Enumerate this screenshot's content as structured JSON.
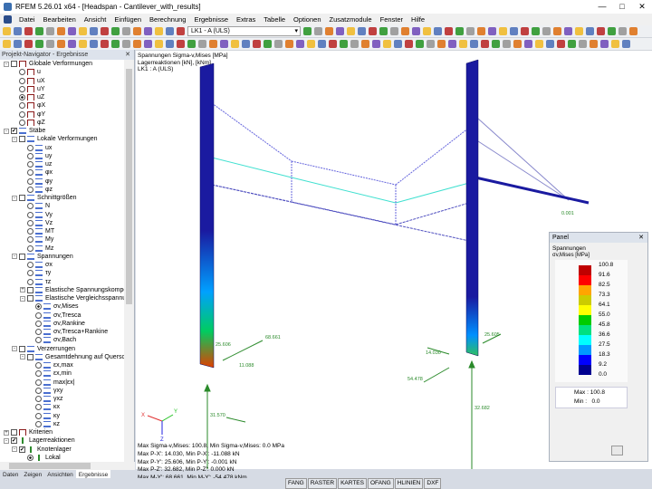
{
  "window": {
    "title": "RFEM 5.26.01 x64 - [Headspan - Cantilever_with_results]",
    "minimize": "—",
    "maximize": "□",
    "close": "✕"
  },
  "menu": [
    "Datei",
    "Bearbeiten",
    "Ansicht",
    "Einfügen",
    "Berechnung",
    "Ergebnisse",
    "Extras",
    "Tabelle",
    "Optionen",
    "Zusatzmodule",
    "Fenster",
    "Hilfe"
  ],
  "toolbar": {
    "loadcase": "LK1 - A (ULS)"
  },
  "navigator": {
    "title": "Projekt-Navigator - Ergebnisse",
    "pin": "ᵖ",
    "close": "✕",
    "items": [
      {
        "label": "Globale Verformungen",
        "level": 0,
        "kind": "chk",
        "icon": "def",
        "pm": "-"
      },
      {
        "label": "u",
        "level": 1,
        "kind": "rad",
        "icon": "def"
      },
      {
        "label": "uX",
        "level": 1,
        "kind": "rad",
        "icon": "def"
      },
      {
        "label": "uY",
        "level": 1,
        "kind": "rad",
        "icon": "def"
      },
      {
        "label": "uZ",
        "level": 1,
        "kind": "rad",
        "icon": "def",
        "on": true
      },
      {
        "label": "φX",
        "level": 1,
        "kind": "rad",
        "icon": "def"
      },
      {
        "label": "φY",
        "level": 1,
        "kind": "rad",
        "icon": "def"
      },
      {
        "label": "φZ",
        "level": 1,
        "kind": "rad",
        "icon": "def"
      },
      {
        "label": "Stäbe",
        "level": 0,
        "kind": "chk",
        "checked": true,
        "icon": "mem",
        "pm": "-"
      },
      {
        "label": "Lokale Verformungen",
        "level": 1,
        "kind": "chk",
        "icon": "mem",
        "pm": "-"
      },
      {
        "label": "ux",
        "level": 2,
        "kind": "rad",
        "icon": "mem"
      },
      {
        "label": "uy",
        "level": 2,
        "kind": "rad",
        "icon": "mem"
      },
      {
        "label": "uz",
        "level": 2,
        "kind": "rad",
        "icon": "mem"
      },
      {
        "label": "φx",
        "level": 2,
        "kind": "rad",
        "icon": "mem"
      },
      {
        "label": "φy",
        "level": 2,
        "kind": "rad",
        "icon": "mem"
      },
      {
        "label": "φz",
        "level": 2,
        "kind": "rad",
        "icon": "mem"
      },
      {
        "label": "Schnittgrößen",
        "level": 1,
        "kind": "chk",
        "icon": "mem",
        "pm": "-"
      },
      {
        "label": "N",
        "level": 2,
        "kind": "rad",
        "icon": "mem"
      },
      {
        "label": "Vy",
        "level": 2,
        "kind": "rad",
        "icon": "mem"
      },
      {
        "label": "Vz",
        "level": 2,
        "kind": "rad",
        "icon": "mem"
      },
      {
        "label": "MT",
        "level": 2,
        "kind": "rad",
        "icon": "mem"
      },
      {
        "label": "My",
        "level": 2,
        "kind": "rad",
        "icon": "mem"
      },
      {
        "label": "Mz",
        "level": 2,
        "kind": "rad",
        "icon": "mem"
      },
      {
        "label": "Spannungen",
        "level": 1,
        "kind": "chk",
        "icon": "mem",
        "pm": "-"
      },
      {
        "label": "σx",
        "level": 2,
        "kind": "rad",
        "icon": "mem"
      },
      {
        "label": "τy",
        "level": 2,
        "kind": "rad",
        "icon": "mem"
      },
      {
        "label": "τz",
        "level": 2,
        "kind": "rad",
        "icon": "mem"
      },
      {
        "label": "Elastische Spannungskomponenten",
        "level": 2,
        "kind": "chk",
        "icon": "mem",
        "pm": "+"
      },
      {
        "label": "Elastische Vergleichsspannungen",
        "level": 2,
        "kind": "chk",
        "icon": "mem",
        "pm": "-"
      },
      {
        "label": "σv,Mises",
        "level": 3,
        "kind": "rad",
        "icon": "mem",
        "on": true
      },
      {
        "label": "σv,Tresca",
        "level": 3,
        "kind": "rad",
        "icon": "mem"
      },
      {
        "label": "σv,Rankine",
        "level": 3,
        "kind": "rad",
        "icon": "mem"
      },
      {
        "label": "σv,Tresca+Rankine",
        "level": 3,
        "kind": "rad",
        "icon": "mem"
      },
      {
        "label": "σv,Bach",
        "level": 3,
        "kind": "rad",
        "icon": "mem"
      },
      {
        "label": "Verzerrungen",
        "level": 1,
        "kind": "chk",
        "icon": "mem",
        "pm": "-"
      },
      {
        "label": "Gesamtdehnung auf Querschnitt",
        "level": 2,
        "kind": "chk",
        "icon": "mem",
        "pm": "-"
      },
      {
        "label": "εx,max",
        "level": 3,
        "kind": "rad",
        "icon": "mem"
      },
      {
        "label": "εx,min",
        "level": 3,
        "kind": "rad",
        "icon": "mem"
      },
      {
        "label": "max|εx|",
        "level": 3,
        "kind": "rad",
        "icon": "mem"
      },
      {
        "label": "γxy",
        "level": 3,
        "kind": "rad",
        "icon": "mem"
      },
      {
        "label": "γxz",
        "level": 3,
        "kind": "rad",
        "icon": "mem"
      },
      {
        "label": "κx",
        "level": 3,
        "kind": "rad",
        "icon": "mem"
      },
      {
        "label": "κy",
        "level": 3,
        "kind": "rad",
        "icon": "mem"
      },
      {
        "label": "κz",
        "level": 3,
        "kind": "rad",
        "icon": "mem"
      },
      {
        "label": "Kriterien",
        "level": 0,
        "kind": "chk",
        "icon": "def",
        "pm": "+"
      },
      {
        "label": "Lagerreaktionen",
        "level": 0,
        "kind": "chk",
        "checked": true,
        "icon": "sup",
        "pm": "-"
      },
      {
        "label": "Knotenlager",
        "level": 1,
        "kind": "chk",
        "checked": true,
        "icon": "sup",
        "pm": "-"
      },
      {
        "label": "Lokal",
        "level": 2,
        "kind": "rad",
        "icon": "sup",
        "on": true
      }
    ],
    "tabs": [
      "Daten",
      "Zeigen",
      "Ansichten",
      "Ergebnisse"
    ]
  },
  "view": {
    "info": [
      "Spannungen Sigma-v,Mises [MPa]",
      "Lagerreaktionen [kN], [kNm]",
      "LK1 : A (ULS)"
    ],
    "minmax": [
      "Max Sigma-v,Mises: 100.8, Min Sigma-v,Mises: 0.0 MPa",
      "Max P-X': 14.030, Min P-X': -11.088 kN",
      "Max P-Y': 25.606, Min P-Y': -0.001 kN",
      "Max P-Z': 32.682, Min P-Z': 0.000 kN",
      "Max M-Y': 68.661, Min M-Y': -54.478 kNm"
    ],
    "labels": {
      "l1": "25.606",
      "l2": "68.661",
      "l3": "11.088",
      "l4": "31.570",
      "r1": "25.605",
      "r2": "14.030",
      "r3": "54.478",
      "r4": "32.682",
      "cant": "0.001"
    },
    "axes": {
      "x": "X",
      "y": "Y",
      "z": "Z"
    }
  },
  "panel": {
    "title": "Panel",
    "close": "✕",
    "heading": "Spannungen",
    "quantity": "σv,Mises [MPa]",
    "scale": [
      "100.8",
      "91.6",
      "82.5",
      "73.3",
      "64.1",
      "55.0",
      "45.8",
      "36.6",
      "27.5",
      "18.3",
      "9.2",
      "0.0"
    ],
    "colors": [
      "#c00000",
      "#ff0000",
      "#ffa500",
      "#cccc00",
      "#ffff00",
      "#00cc00",
      "#00e080",
      "#00ffff",
      "#0099ff",
      "#0000ff",
      "#000090"
    ],
    "max_label": "Max :",
    "max": "100.8",
    "min_label": "Min :",
    "min": "0.0"
  },
  "status": [
    "FANG",
    "RASTER",
    "KARTES",
    "OFANG",
    "HLINIEN",
    "DXF"
  ]
}
